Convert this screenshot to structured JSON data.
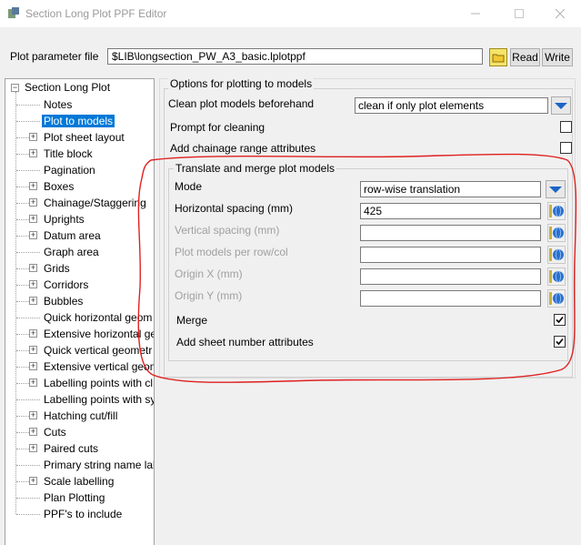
{
  "window": {
    "title": "Section Long Plot PPF Editor",
    "controls": [
      "minimize",
      "maximize",
      "close"
    ]
  },
  "param_row": {
    "label": "Plot parameter file",
    "value": "$LIB\\longsection_PW_A3_basic.lplotppf",
    "read_label": "Read",
    "write_label": "Write"
  },
  "tree": {
    "root": "Section Long Plot",
    "items": [
      {
        "label": "Notes",
        "expandable": false,
        "selected": false
      },
      {
        "label": "Plot to models",
        "expandable": false,
        "selected": true
      },
      {
        "label": "Plot sheet layout",
        "expandable": true,
        "selected": false
      },
      {
        "label": "Title block",
        "expandable": true,
        "selected": false
      },
      {
        "label": "Pagination",
        "expandable": false,
        "selected": false
      },
      {
        "label": "Boxes",
        "expandable": true,
        "selected": false
      },
      {
        "label": "Chainage/Staggering",
        "expandable": true,
        "selected": false
      },
      {
        "label": "Uprights",
        "expandable": true,
        "selected": false
      },
      {
        "label": "Datum area",
        "expandable": true,
        "selected": false
      },
      {
        "label": "Graph area",
        "expandable": false,
        "selected": false
      },
      {
        "label": "Grids",
        "expandable": true,
        "selected": false
      },
      {
        "label": "Corridors",
        "expandable": true,
        "selected": false
      },
      {
        "label": "Bubbles",
        "expandable": true,
        "selected": false
      },
      {
        "label": "Quick horizontal geom",
        "expandable": false,
        "selected": false
      },
      {
        "label": "Extensive horizontal ge",
        "expandable": true,
        "selected": false
      },
      {
        "label": "Quick vertical geometr",
        "expandable": true,
        "selected": false
      },
      {
        "label": "Extensive vertical geom",
        "expandable": true,
        "selected": false
      },
      {
        "label": "Labelling points with cl",
        "expandable": true,
        "selected": false
      },
      {
        "label": "Labelling points with sy",
        "expandable": false,
        "selected": false
      },
      {
        "label": "Hatching cut/fill",
        "expandable": true,
        "selected": false
      },
      {
        "label": "Cuts",
        "expandable": true,
        "selected": false
      },
      {
        "label": "Paired cuts",
        "expandable": true,
        "selected": false
      },
      {
        "label": "Primary string name lal",
        "expandable": false,
        "selected": false
      },
      {
        "label": "Scale labelling",
        "expandable": true,
        "selected": false
      },
      {
        "label": "Plan Plotting",
        "expandable": false,
        "selected": false
      },
      {
        "label": "PPF's to include",
        "expandable": false,
        "selected": false
      }
    ]
  },
  "options": {
    "group_title": "Options for plotting to models",
    "clean_label": "Clean plot models beforehand",
    "clean_value": "clean if only plot elements",
    "prompt_label": "Prompt for cleaning",
    "prompt_checked": false,
    "chainage_label": "Add chainage range attributes",
    "chainage_checked": false
  },
  "translate": {
    "group_title": "Translate and merge plot models",
    "mode_label": "Mode",
    "mode_value": "row-wise translation",
    "hspacing_label": "Horizontal spacing (mm)",
    "hspacing_value": "425",
    "vspacing_label": "Vertical spacing (mm)",
    "vspacing_value": "",
    "per_row_label": "Plot models per row/col",
    "per_row_value": "",
    "origin_x_label": "Origin X (mm)",
    "origin_x_value": "",
    "origin_y_label": "Origin Y (mm)",
    "origin_y_value": "",
    "merge_label": "Merge",
    "merge_checked": true,
    "sheet_label": "Add sheet number attributes",
    "sheet_checked": true
  },
  "colors": {
    "selection": "#0078d7",
    "annotation": "#e02020",
    "dropdown_arrow": "#1a64c8"
  }
}
